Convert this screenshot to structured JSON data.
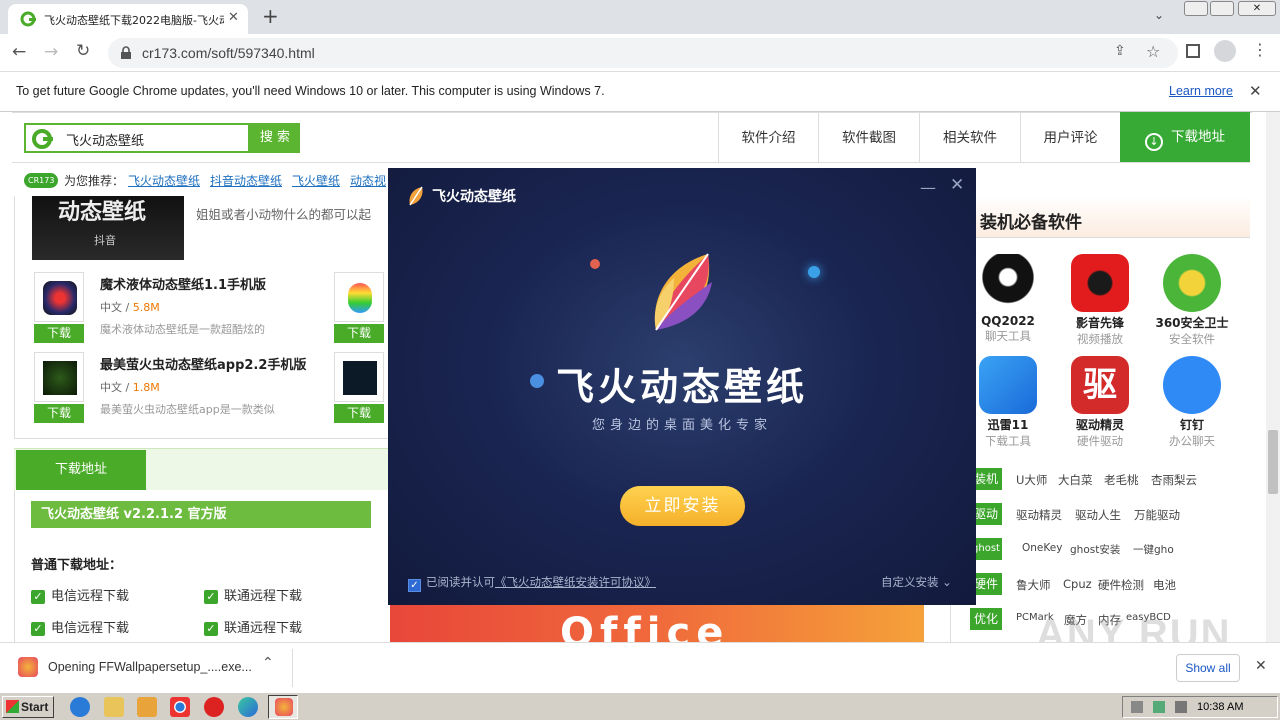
{
  "browser": {
    "tab_title": "飞火动态壁纸下载2022电脑版-飞火动",
    "url": "cr173.com/soft/597340.html",
    "infobar_message": "To get future Google Chrome updates, you'll need Windows 10 or later. This computer is using Windows 7.",
    "infobar_link": "Learn more"
  },
  "site": {
    "search_value": "飞火动态壁纸",
    "search_button": "搜 索",
    "nav": [
      "软件介绍",
      "软件截图",
      "相关软件",
      "用户评论"
    ],
    "nav_download": "下载地址",
    "rec_badge": "CR173",
    "rec_label": "为您推荐：",
    "rec_links": [
      "飞火动态壁纸",
      "抖音动态壁纸",
      "飞火壁纸",
      "动态视"
    ],
    "banner_text": "动态壁纸",
    "banner_sub": "抖音",
    "intro_text": "姐姐或者小动物什么的都可以起",
    "items": [
      {
        "title": "魔术液体动态壁纸1.1手机版",
        "lang": "中文 / ",
        "size": "5.8M",
        "desc": "魔术液体动态壁纸是一款超酷炫的",
        "button": "下载"
      },
      {
        "title": "最美萤火虫动态壁纸app2.2手机版",
        "lang": "中文 / ",
        "size": "1.8M",
        "desc": "最美萤火虫动态壁纸app是一款类似",
        "button": "下载"
      }
    ],
    "side_button_1": "下载",
    "side_button_2": "下载",
    "download_tab": "下载地址",
    "version_bar": "飞火动态壁纸 v2.2.1.2 官方版",
    "normal_label": "普通下载地址：",
    "links": [
      "电信远程下载",
      "联通远程下载",
      "电信远程下载",
      "联通远程下载"
    ]
  },
  "right": {
    "heading": "装机必备软件",
    "apps": [
      {
        "name": "QQ2022",
        "sub": "聊天工具"
      },
      {
        "name": "影音先锋",
        "sub": "视频播放"
      },
      {
        "name": "360安全卫士",
        "sub": "安全软件"
      },
      {
        "name": "迅雷11",
        "sub": "下载工具"
      },
      {
        "name": "驱动精灵",
        "sub": "硬件驱动"
      },
      {
        "name": "钉钉",
        "sub": "办公聊天"
      }
    ],
    "tags": [
      {
        "tag": "装机",
        "words": [
          "U大师",
          "大白菜",
          "老毛桃",
          "杏雨梨云"
        ]
      },
      {
        "tag": "驱动",
        "words": [
          "驱动精灵",
          "驱动人生",
          "万能驱动"
        ]
      },
      {
        "tag": "ghost",
        "words": [
          "OneKey",
          "ghost安装",
          "一键gho"
        ]
      },
      {
        "tag": "硬件",
        "words": [
          "鲁大师",
          "Cpuz",
          "硬件检测",
          "电池"
        ]
      },
      {
        "tag": "优化",
        "words": [
          "PCMark",
          "魔方",
          "内存",
          "easyBCD"
        ]
      }
    ],
    "ad_text": "Office"
  },
  "dialog": {
    "title": "飞火动态壁纸",
    "app_name": "飞火动态壁纸",
    "slogan": "您身边的桌面美化专家",
    "install_button": "立即安装",
    "agree_prefix": "已阅读并认可",
    "agree_link": "《飞火动态壁纸安装许可协议》",
    "custom_install": "自定义安装"
  },
  "downloads_bar": {
    "file": "Opening FFWallpapersetup_....exe...",
    "show_all": "Show all"
  },
  "taskbar": {
    "start": "Start",
    "clock": "10:38 AM"
  },
  "watermark": "ANY RUN",
  "colors": {
    "green": "#3ca52c",
    "accent_blue": "#1a57c4",
    "dialog_bg": "#1a2552",
    "install": "#f5b02a"
  }
}
